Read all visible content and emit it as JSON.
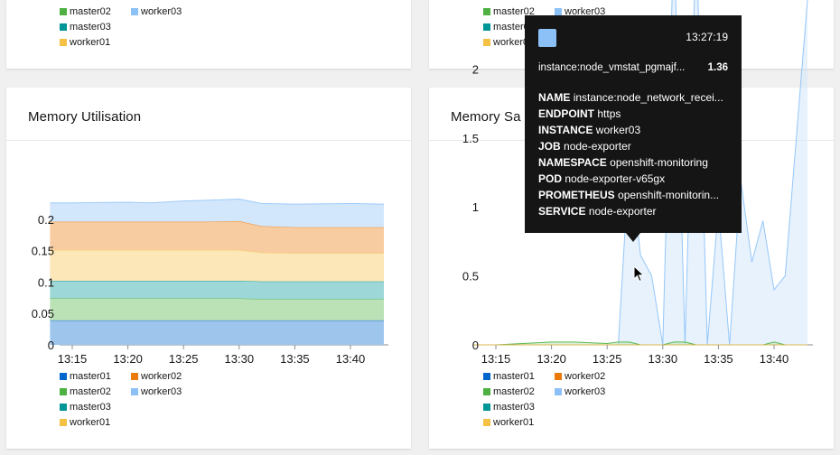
{
  "top_left_legend": [
    {
      "label": "master02",
      "color": "#4cb140"
    },
    {
      "label": "worker03",
      "color": "#8bc1f7"
    },
    {
      "label": "master03",
      "color": "#009596"
    },
    {
      "label": "worker01",
      "color": "#f4c145"
    }
  ],
  "top_right_legend": [
    {
      "label": "master02",
      "color": "#4cb140"
    },
    {
      "label": "worker03",
      "color": "#8bc1f7"
    },
    {
      "label": "master03",
      "color": "#009596"
    },
    {
      "label": "worker01",
      "color": "#f4c145"
    }
  ],
  "memory_utilisation": {
    "title": "Memory Utilisation",
    "legend": [
      {
        "label": "master01",
        "color": "#06c"
      },
      {
        "label": "worker02",
        "color": "#ec7a08"
      },
      {
        "label": "master02",
        "color": "#4cb140"
      },
      {
        "label": "worker03",
        "color": "#8bc1f7"
      },
      {
        "label": "master03",
        "color": "#009596"
      },
      {
        "label": "worker01",
        "color": "#f4c145"
      }
    ]
  },
  "memory_saturation": {
    "title": "Memory Sa",
    "legend": [
      {
        "label": "master01",
        "color": "#06c"
      },
      {
        "label": "worker02",
        "color": "#ec7a08"
      },
      {
        "label": "master02",
        "color": "#4cb140"
      },
      {
        "label": "worker03",
        "color": "#8bc1f7"
      },
      {
        "label": "master03",
        "color": "#009596"
      },
      {
        "label": "worker01",
        "color": "#f4c145"
      }
    ]
  },
  "tooltip": {
    "time": "13:27:19",
    "series_name": "instance:node_vmstat_pgmajf...",
    "value": "1.36",
    "color": "#8bc1f7",
    "rows": [
      {
        "key": "NAME",
        "value": "instance:node_network_recei..."
      },
      {
        "key": "ENDPOINT",
        "value": "https"
      },
      {
        "key": "INSTANCE",
        "value": "worker03"
      },
      {
        "key": "JOB",
        "value": "node-exporter"
      },
      {
        "key": "NAMESPACE",
        "value": "openshift-monitoring"
      },
      {
        "key": "POD",
        "value": "node-exporter-v65gx"
      },
      {
        "key": "PROMETHEUS",
        "value": "openshift-monitorin..."
      },
      {
        "key": "SERVICE",
        "value": "node-exporter"
      }
    ]
  },
  "chart_data": [
    {
      "type": "area",
      "title": "Memory Utilisation",
      "stacked": true,
      "x": [
        "13:13",
        "13:15",
        "13:20",
        "13:22",
        "13:25",
        "13:27",
        "13:30",
        "13:32",
        "13:35",
        "13:40",
        "13:43"
      ],
      "xticks": [
        "13:15",
        "13:20",
        "13:25",
        "13:30",
        "13:35",
        "13:40"
      ],
      "yticks": [
        "0",
        "0.05",
        "0.1",
        "0.15",
        "0.2"
      ],
      "ylim": [
        0,
        0.25
      ],
      "grid": false,
      "legend_position": "bottom",
      "series": [
        {
          "name": "master01",
          "color": "#06c",
          "values": [
            0.039,
            0.039,
            0.039,
            0.039,
            0.039,
            0.039,
            0.039,
            0.039,
            0.039,
            0.039,
            0.039
          ]
        },
        {
          "name": "master02",
          "color": "#4cb140",
          "values": [
            0.035,
            0.035,
            0.035,
            0.035,
            0.035,
            0.035,
            0.035,
            0.034,
            0.034,
            0.034,
            0.034
          ]
        },
        {
          "name": "master03",
          "color": "#009596",
          "values": [
            0.028,
            0.028,
            0.028,
            0.028,
            0.028,
            0.028,
            0.028,
            0.028,
            0.028,
            0.028,
            0.028
          ]
        },
        {
          "name": "worker01",
          "color": "#f4c145",
          "values": [
            0.049,
            0.049,
            0.049,
            0.049,
            0.049,
            0.049,
            0.049,
            0.046,
            0.045,
            0.045,
            0.045
          ]
        },
        {
          "name": "worker02",
          "color": "#ec7a08",
          "values": [
            0.045,
            0.045,
            0.045,
            0.045,
            0.045,
            0.045,
            0.046,
            0.042,
            0.041,
            0.041,
            0.041
          ]
        },
        {
          "name": "worker03",
          "color": "#8bc1f7",
          "values": [
            0.03,
            0.03,
            0.031,
            0.03,
            0.033,
            0.034,
            0.035,
            0.036,
            0.037,
            0.038,
            0.037
          ]
        }
      ]
    },
    {
      "type": "area",
      "title": "Memory Saturation",
      "x": [
        "13:13",
        "13:15",
        "13:20",
        "13:22",
        "13:25",
        "13:26",
        "13:27",
        "13:28",
        "13:29",
        "13:30",
        "13:31",
        "13:32",
        "13:33",
        "13:34",
        "13:35",
        "13:36",
        "13:37",
        "13:38",
        "13:39",
        "13:40",
        "13:41",
        "13:42",
        "13:43"
      ],
      "xticks": [
        "13:15",
        "13:20",
        "13:25",
        "13:30",
        "13:35",
        "13:40"
      ],
      "yticks": [
        "0",
        "0.5",
        "1",
        "1.5",
        "2"
      ],
      "ylim": [
        0,
        2.5
      ],
      "grid": false,
      "legend_position": "bottom",
      "series": [
        {
          "name": "worker03",
          "color": "#8bc1f7",
          "values": [
            0,
            0,
            0,
            0,
            0,
            0,
            1.36,
            0.65,
            0.5,
            0,
            3.0,
            0,
            3.0,
            0,
            1.0,
            0,
            1.2,
            0.6,
            0.9,
            0.4,
            0.5,
            1.5,
            2.5
          ]
        },
        {
          "name": "master02",
          "color": "#4cb140",
          "values": [
            0,
            0,
            0.02,
            0.02,
            0.01,
            0.02,
            0.02,
            0,
            0,
            0,
            0.02,
            0.02,
            0,
            0,
            0,
            0,
            0,
            0,
            0,
            0.02,
            0,
            0,
            0
          ]
        },
        {
          "name": "master03",
          "color": "#009596",
          "values": [
            0,
            0,
            0,
            0,
            0,
            0,
            0,
            0,
            0,
            0,
            0,
            0,
            0,
            0,
            0,
            0,
            0,
            0,
            0,
            0,
            0,
            0,
            0
          ]
        },
        {
          "name": "worker02",
          "color": "#ec7a08",
          "values": [
            0,
            0,
            0,
            0,
            0,
            0,
            0,
            0,
            0,
            0,
            0,
            0,
            0,
            0,
            0,
            0,
            0,
            0,
            0,
            0,
            0,
            0,
            0
          ]
        },
        {
          "name": "master01",
          "color": "#06c",
          "values": [
            0,
            0,
            0,
            0,
            0,
            0,
            0,
            0,
            0,
            0,
            0,
            0,
            0,
            0,
            0,
            0,
            0,
            0,
            0,
            0,
            0,
            0,
            0
          ]
        },
        {
          "name": "worker01",
          "color": "#f4c145",
          "values": [
            0,
            0,
            0,
            0,
            0,
            0,
            0,
            0,
            0,
            0,
            0,
            0,
            0,
            0,
            0,
            0,
            0,
            0,
            0,
            0,
            0,
            0,
            0
          ]
        }
      ]
    }
  ]
}
